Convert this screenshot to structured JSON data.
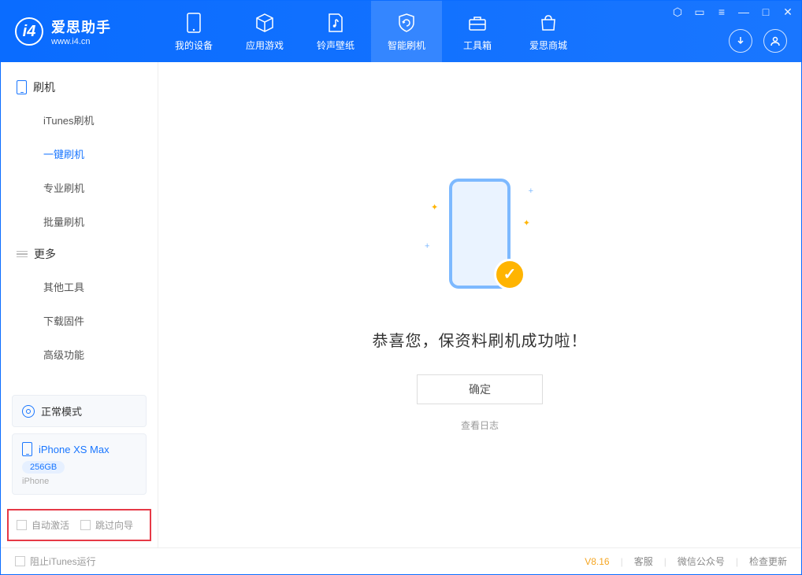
{
  "app": {
    "name": "爱思助手",
    "url": "www.i4.cn"
  },
  "nav": {
    "tabs": [
      {
        "label": "我的设备"
      },
      {
        "label": "应用游戏"
      },
      {
        "label": "铃声壁纸"
      },
      {
        "label": "智能刷机"
      },
      {
        "label": "工具箱"
      },
      {
        "label": "爱思商城"
      }
    ]
  },
  "sidebar": {
    "group1": {
      "title": "刷机"
    },
    "items1": [
      {
        "label": "iTunes刷机"
      },
      {
        "label": "一键刷机"
      },
      {
        "label": "专业刷机"
      },
      {
        "label": "批量刷机"
      }
    ],
    "group2": {
      "title": "更多"
    },
    "items2": [
      {
        "label": "其他工具"
      },
      {
        "label": "下载固件"
      },
      {
        "label": "高级功能"
      }
    ],
    "mode": "正常模式",
    "device": {
      "name": "iPhone XS Max",
      "capacity": "256GB",
      "type": "iPhone"
    },
    "checkboxes": {
      "auto_activate": "自动激活",
      "skip_guide": "跳过向导"
    }
  },
  "main": {
    "success_text": "恭喜您，保资料刷机成功啦！",
    "ok_button": "确定",
    "view_log": "查看日志"
  },
  "statusbar": {
    "block_itunes": "阻止iTunes运行",
    "version": "V8.16",
    "links": [
      "客服",
      "微信公众号",
      "检查更新"
    ]
  }
}
